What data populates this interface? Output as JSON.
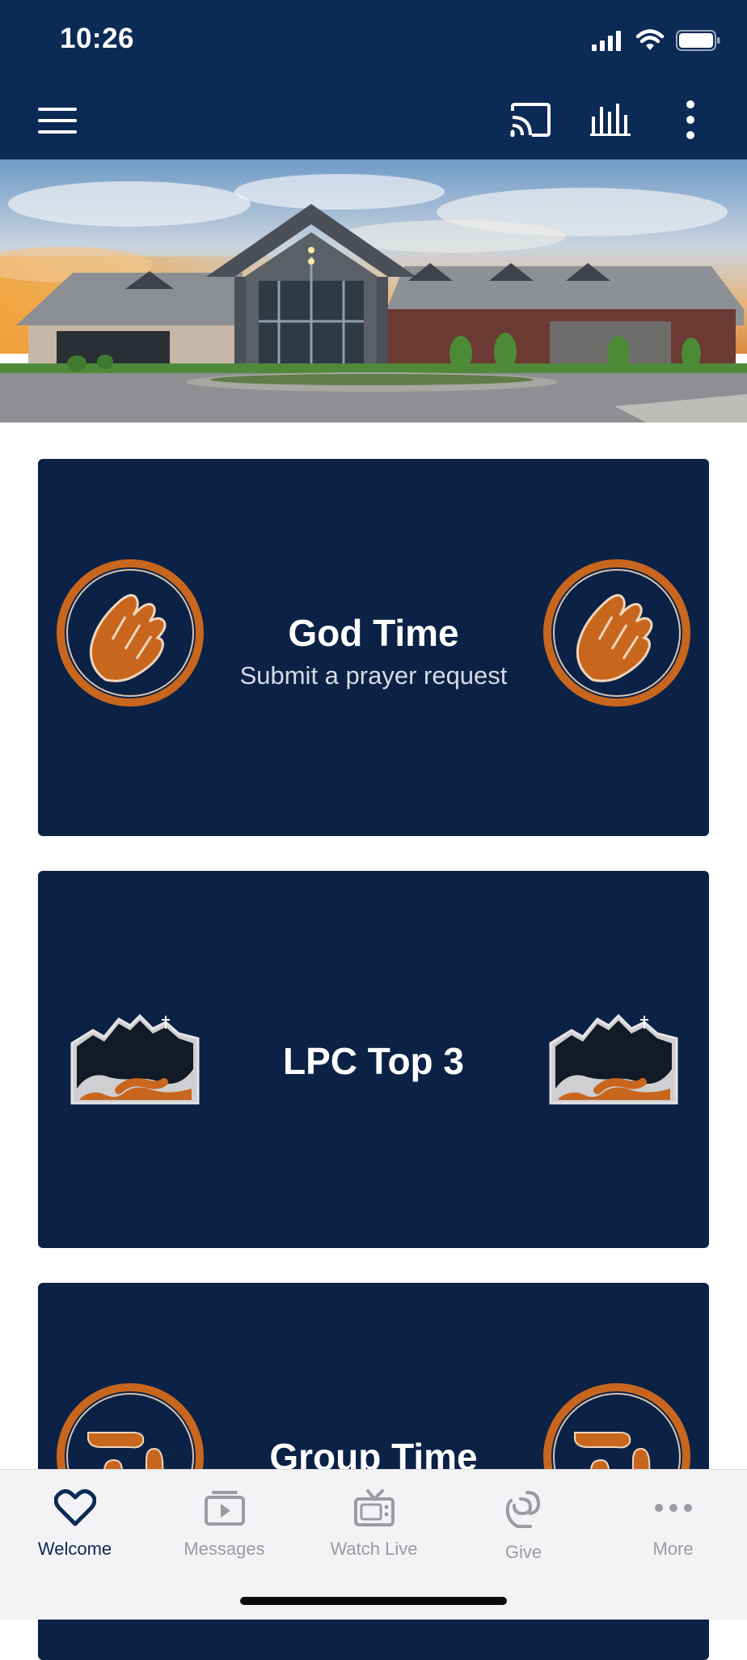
{
  "status": {
    "time": "10:26"
  },
  "app_bar": {
    "menu_icon": "hamburger-icon",
    "cast_icon": "cast-icon",
    "audio_icon": "audio-bars-icon",
    "more_icon": "vertical-dots-icon"
  },
  "hero": {
    "alt": "church-building-photo"
  },
  "cards": [
    {
      "title": "God Time",
      "subtitle": "Submit a prayer request",
      "icon": "praying-hands-icon"
    },
    {
      "title": "LPC Top 3",
      "subtitle": "",
      "icon": "mountain-logo-icon"
    },
    {
      "title": "Group Time",
      "subtitle": "",
      "icon": "hands-group-icon"
    }
  ],
  "tabs": [
    {
      "label": "Welcome",
      "icon": "heart-icon",
      "active": true
    },
    {
      "label": "Messages",
      "icon": "play-stack-icon",
      "active": false
    },
    {
      "label": "Watch Live",
      "icon": "tv-icon",
      "active": false
    },
    {
      "label": "Give",
      "icon": "give-icon",
      "active": false
    },
    {
      "label": "More",
      "icon": "horizontal-dots-icon",
      "active": false
    }
  ],
  "colors": {
    "primary": "#0b2a55",
    "card": "#0b2246",
    "accent": "#c8661e"
  }
}
